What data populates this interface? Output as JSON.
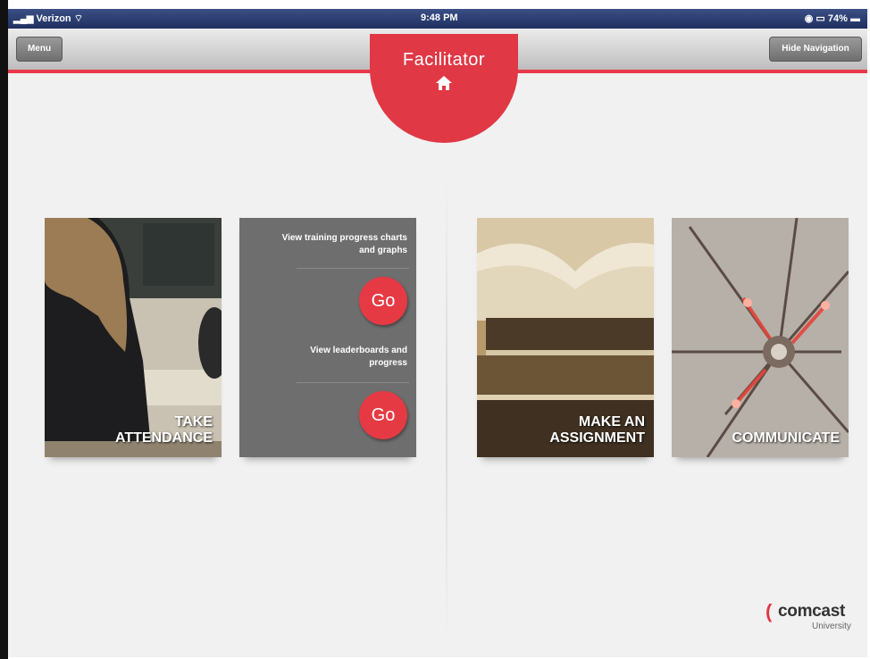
{
  "statusbar": {
    "carrier": "Verizon",
    "time": "9:48 PM",
    "battery": "74%"
  },
  "navbar": {
    "menu_label": "Menu",
    "hide_nav_label": "Hide Navigation"
  },
  "header": {
    "title": "Facilitator",
    "home_icon": "home-icon"
  },
  "tiles": {
    "attendance": {
      "label": "TAKE ATTENDANCE"
    },
    "progress": {
      "item_a_text": "View training progress charts and graphs",
      "item_a_button": "Go",
      "item_b_text": "View leaderboards and progress",
      "item_b_button": "Go"
    },
    "assignment": {
      "label": "MAKE AN ASSIGNMENT"
    },
    "communicate": {
      "label": "COMMUNICATE"
    }
  },
  "logo": {
    "wordmark": "comcast",
    "sub": "University"
  },
  "colors": {
    "accent": "#e03845",
    "nav_bar": "#d0d0d0",
    "status_bar": "#2c3e73"
  }
}
